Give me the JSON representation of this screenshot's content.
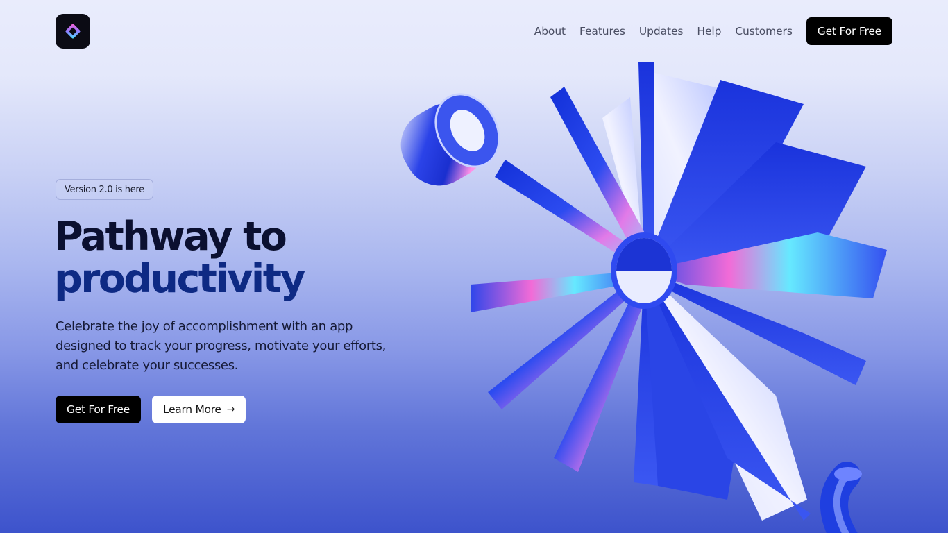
{
  "brand": {
    "logo_icon": "diamond-gradient-icon"
  },
  "nav": {
    "links": [
      "About",
      "Features",
      "Updates",
      "Help",
      "Customers"
    ],
    "cta_label": "Get For Free"
  },
  "hero": {
    "badge": "Version 2.0 is here",
    "title_line1": "Pathway to",
    "title_line2": "productivity",
    "description": "Celebrate the joy of accomplishment with an app designed to track your progress, motivate your efforts, and celebrate your successes.",
    "primary_label": "Get For Free",
    "secondary_label": "Learn More",
    "secondary_icon": "arrow-right-icon"
  },
  "colors": {
    "accent": "#0e2a84",
    "button_bg": "#000000",
    "shape_blue": "#1f3fe0"
  }
}
